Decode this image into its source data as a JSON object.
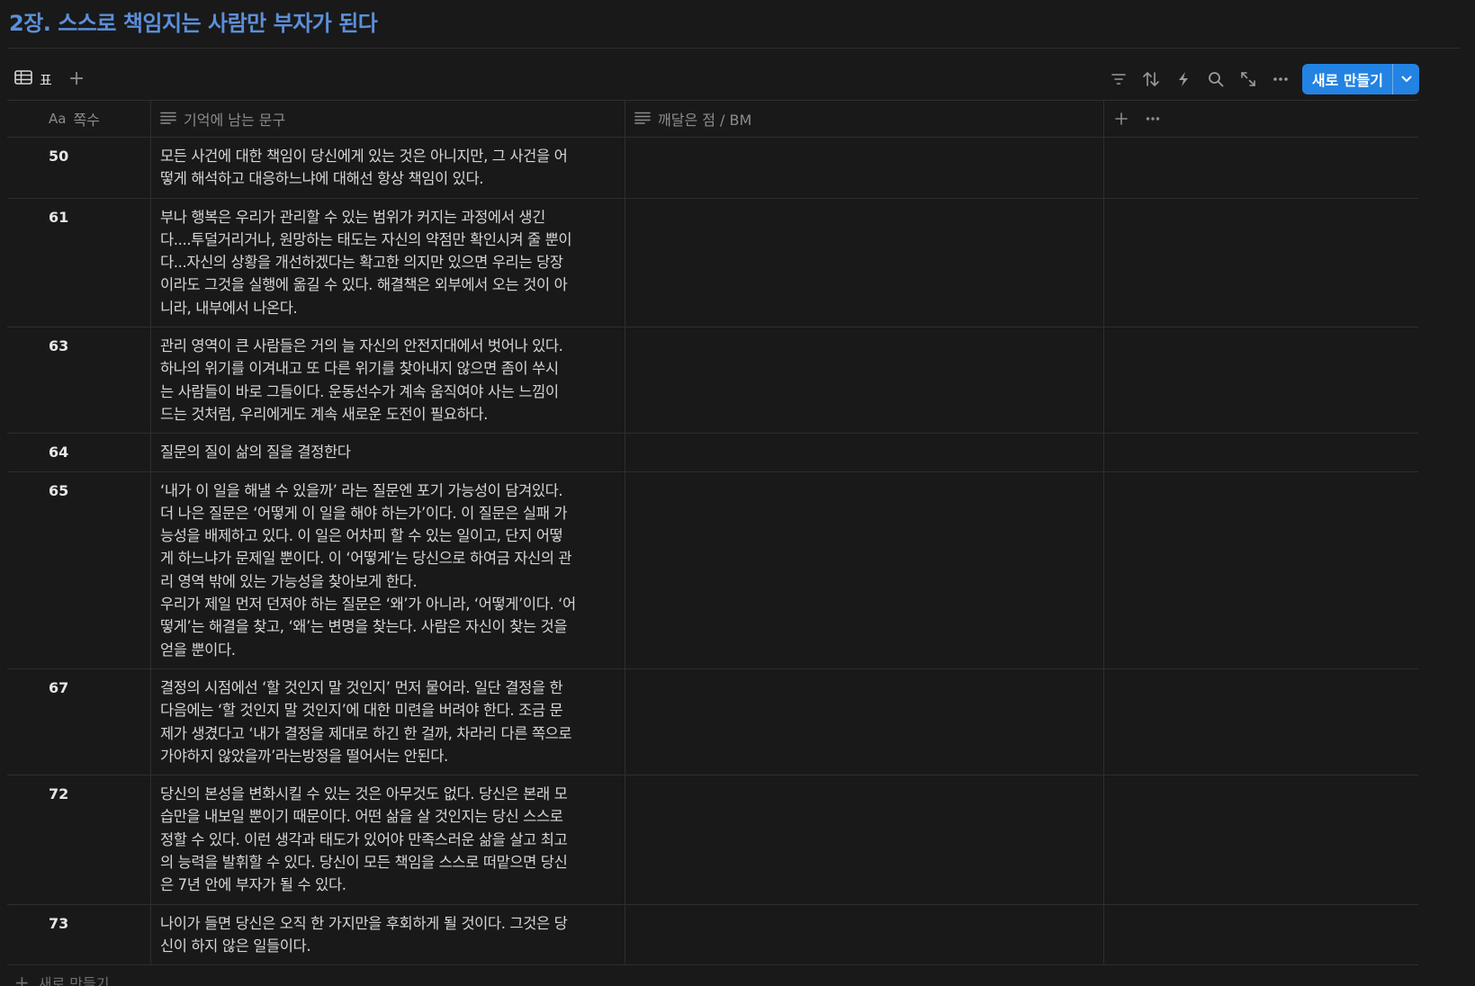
{
  "page": {
    "title": "2장. 스스로 책임지는 사람만 부자가 된다"
  },
  "toolbar": {
    "view_label": "표",
    "new_label": "새로 만들기",
    "icons": [
      "filter-icon",
      "sort-icon",
      "automation-icon",
      "search-icon",
      "expand-icon",
      "more-icon"
    ]
  },
  "table": {
    "columns": [
      {
        "type_label": "Aa",
        "label": "쪽수"
      },
      {
        "label": "기억에 남는 문구"
      },
      {
        "label": "깨달은 점 / BM"
      }
    ],
    "rows": [
      {
        "page": "50",
        "quote": "모든 사건에 대한 책임이 당신에게 있는 것은 아니지만, 그 사건을 어\n떻게 해석하고 대응하느냐에 대해선 항상 책임이 있다.",
        "insight": ""
      },
      {
        "page": "61",
        "quote": "부나 행복은 우리가 관리할 수 있는 범위가 커지는 과정에서 생긴\n다....투덜거리거나, 원망하는 태도는 자신의 약점만 확인시켜 줄 뿐이\n다...자신의 상황을 개선하겠다는 확고한 의지만 있으면 우리는 당장\n이라도 그것을 실행에 옮길 수 있다. 해결책은 외부에서 오는 것이 아\n니라, 내부에서 나온다.",
        "insight": ""
      },
      {
        "page": "63",
        "quote": "관리 영역이 큰 사람들은 거의 늘 자신의 안전지대에서 벗어나 있다.\n하나의 위기를 이겨내고 또 다른 위기를 찾아내지 않으면 좀이 쑤시\n는 사람들이 바로 그들이다. 운동선수가 계속 움직여야 사는 느낌이\n드는 것처럼, 우리에게도 계속 새로운 도전이 필요하다.",
        "insight": ""
      },
      {
        "page": "64",
        "quote": "질문의 질이 삶의 질을 결정한다",
        "insight": ""
      },
      {
        "page": "65",
        "quote": "‘내가 이 일을 해낼 수 있을까’ 라는 질문엔 포기 가능성이 담겨있다.\n더 나은 질문은 ‘어떻게 이 일을 해야 하는가’이다. 이 질문은 실패 가\n능성을 배제하고 있다. 이 일은 어차피 할 수 있는 일이고, 단지 어떻\n게 하느냐가 문제일 뿐이다. 이 ‘어떻게’는 당신으로 하여금 자신의 관\n리 영역 밖에 있는 가능성을 찾아보게 한다.\n우리가 제일 먼저 던져야 하는 질문은 ‘왜’가 아니라, ‘어떻게’이다. ‘어\n떻게’는 해결을 찾고, ‘왜’는 변명을 찾는다. 사람은 자신이 찾는 것을\n얻을 뿐이다.",
        "insight": ""
      },
      {
        "page": "67",
        "quote": "결정의 시점에선 ‘할 것인지 말 것인지’ 먼저 물어라. 일단 결정을 한\n다음에는 ‘할 것인지 말 것인지’에 대한 미련을 버려야 한다. 조금 문\n제가 생겼다고 ‘내가 결정을 제대로 하긴 한 걸까, 차라리 다른 쪽으로\n가야하지 않았을까’라는방정을 떨어서는 안된다.",
        "insight": ""
      },
      {
        "page": "72",
        "quote": "당신의 본성을 변화시킬 수 있는 것은 아무것도 없다. 당신은 본래 모\n습만을 내보일 뿐이기 때문이다. 어떤 삶을 살 것인지는 당신 스스로\n정할 수 있다. 이런 생각과 태도가 있어야 만족스러운 삶을 살고 최고\n의 능력을 발휘할 수 있다. 당신이 모든 책임을 스스로 떠맡으면 당신\n은 7년 안에 부자가 될 수 있다.",
        "insight": ""
      },
      {
        "page": "73",
        "quote": "나이가 들면 당신은 오직 한 가지만을 후회하게 될 것이다. 그것은 당\n신이 하지 않은 일들이다.",
        "insight": ""
      }
    ],
    "add_row_label": "새로 만들기"
  },
  "colors": {
    "accent": "#2383e2",
    "title": "#5b8fd9",
    "background": "#191919"
  }
}
